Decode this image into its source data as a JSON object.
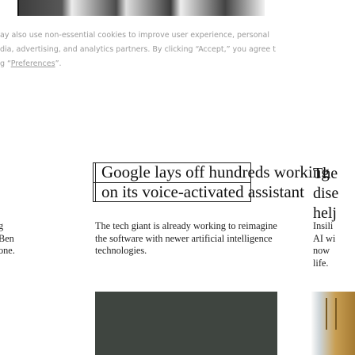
{
  "cookie_notice": {
    "line1": "ay also use non-essential cookies to improve user experience, personal",
    "line2": "dia, advertising, and analytics partners. By clicking “Accept,” you agree t",
    "line3_prefix": "g “",
    "preferences_link": "Preferences",
    "line3_suffix": "”."
  },
  "story": {
    "headline": "Google lays off hundreds working\non its voice-activated assistant",
    "summary": "The tech giant is already working to reimagine the software with newer artificial intelligence technologies."
  },
  "left_column": {
    "text": "g\nBen\none."
  },
  "right_column": {
    "headline": "The\ndise\nhelj",
    "summary": "Insili\nAI wi\nnow\nlife."
  }
}
